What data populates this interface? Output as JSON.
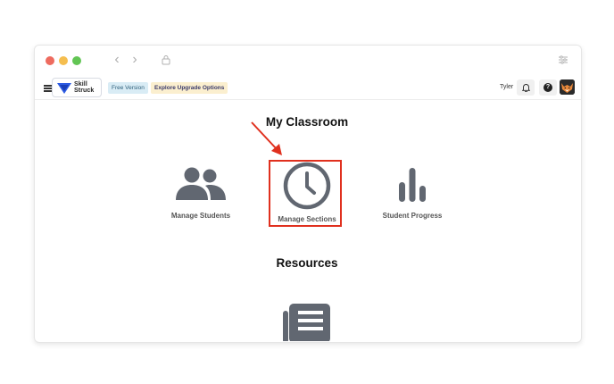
{
  "browser": {
    "traffic_lights": [
      "close",
      "minimize",
      "maximize"
    ],
    "back_label": "‹",
    "forward_label": "›"
  },
  "appbar": {
    "logo_line1": "Skill",
    "logo_line2": "Struck",
    "free_badge": "Free Version",
    "upgrade_badge": "Explore Upgrade Options",
    "username": "Tyler",
    "help_label": "?"
  },
  "main": {
    "classroom_title": "My Classroom",
    "cards": [
      {
        "label": "Manage Students",
        "icon": "people-icon"
      },
      {
        "label": "Manage Sections",
        "icon": "clock-icon"
      },
      {
        "label": "Student Progress",
        "icon": "bar-chart-icon"
      }
    ],
    "resources_title": "Resources",
    "resources_icon": "newspaper-icon"
  },
  "annotation": {
    "color": "#e0301e"
  },
  "colors": {
    "icon_gray": "#616771"
  }
}
